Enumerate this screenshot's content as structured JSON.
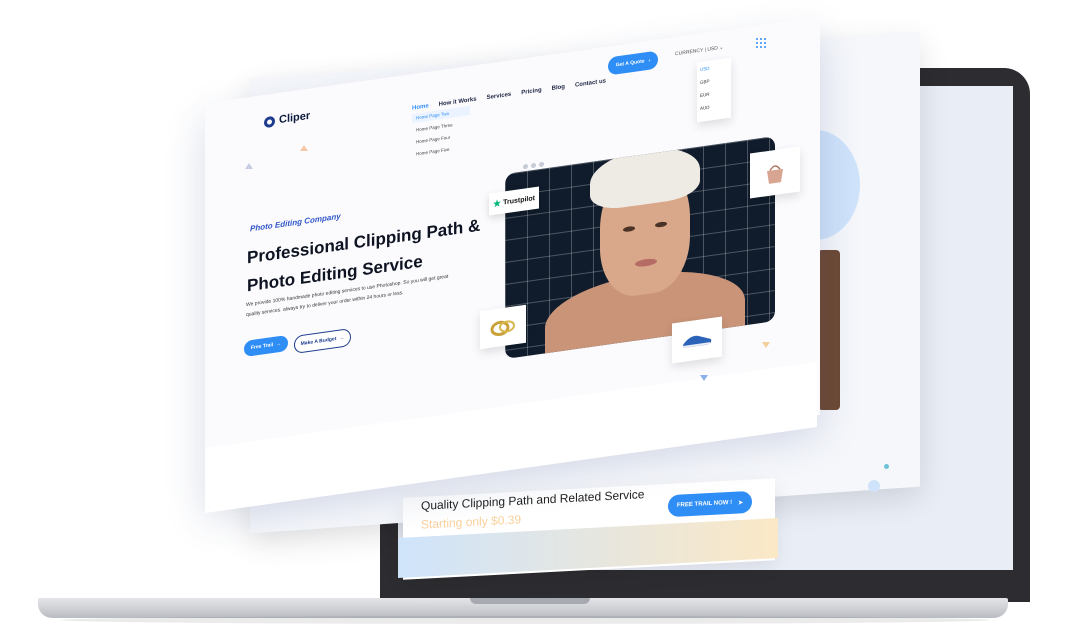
{
  "brand": {
    "name": "Cliper"
  },
  "nav": {
    "items": [
      "Home",
      "How it Works",
      "Services",
      "Pricing",
      "Blog",
      "Contact us"
    ],
    "active": "Home",
    "cta": "Get A Quote"
  },
  "home_menu": [
    "Home Page Two",
    "Home Page Three",
    "Home Page Four",
    "Home Page Five"
  ],
  "currency": {
    "label": "CURRENCY",
    "selected": "USD",
    "options": [
      "USD",
      "GBP",
      "EUR",
      "AUD"
    ]
  },
  "hero": {
    "tagline": "Photo Editing Company",
    "headline_line1": "Professional Clipping Path &",
    "headline_line2": "Photo Editing Service",
    "paragraph": "We provide 100% handmade photo editing services to use Photoshop. So you will get great quality services. always try to deliver your order within 24 hours or less.",
    "primary_button": "Free Trail",
    "secondary_button": "Make A Budget"
  },
  "badges": {
    "trustpilot": "Trustpilot"
  },
  "service_banner": {
    "title": "Quality Clipping Path and Related Service",
    "subtitle": "Starting only $0.39",
    "button": "FREE TRAIL NOW !"
  },
  "colors": {
    "accent": "#2f8ef5",
    "navy": "#1d3c8f",
    "laptop": "#2d2d31"
  }
}
